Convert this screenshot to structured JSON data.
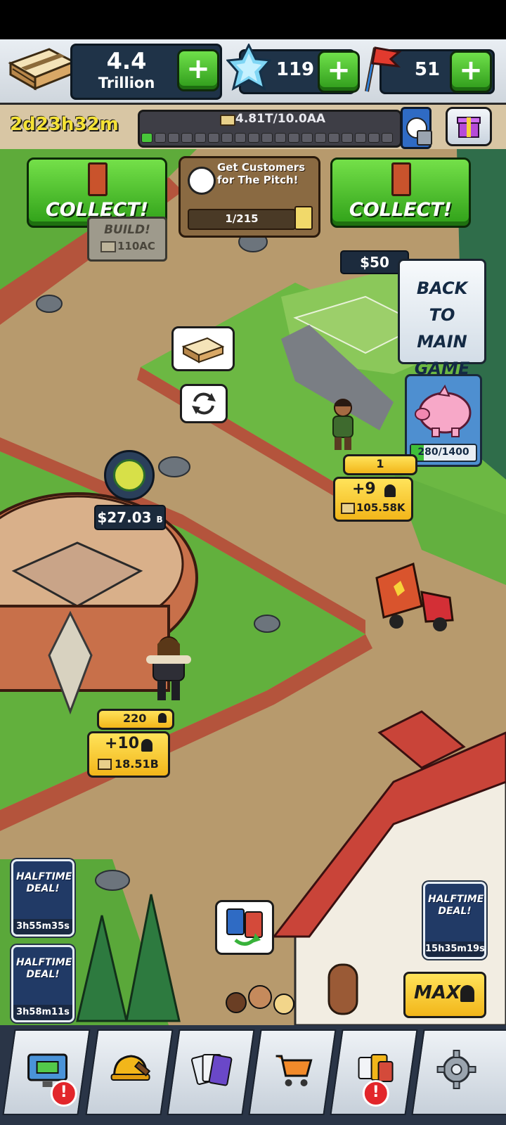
{
  "resources": {
    "cash_value": "4.4",
    "cash_unit": "Trillion",
    "gems": "119",
    "flags": "51"
  },
  "event": {
    "timer": "2d23h32m",
    "progress_text": "4.81T/10.0AA"
  },
  "field": {
    "collect_left": "COLLECT!",
    "collect_right": "COLLECT!",
    "build_label": "BUILD!",
    "build_cost": "110AC",
    "quest_title": "Get Customers for The Pitch!",
    "quest_progress": "1/215",
    "pitch_price": "$50",
    "back_to_main": "BACK TO MAIN GAME",
    "piggy_progress": "280/1400",
    "pitch_level": "1",
    "pitch_plus": "+9",
    "pitch_income": "105.58K",
    "arena_price": "$27.03",
    "arena_price_unit": "B",
    "arena_level": "220",
    "arena_plus": "+10",
    "arena_income": "18.51B",
    "max_label": "MAX"
  },
  "deals": {
    "deal1_title": "HALFTIME DEAL!",
    "deal1_timer": "3h55m35s",
    "deal2_title": "HALFTIME DEAL!",
    "deal2_timer": "3h58m11s",
    "deal3_title": "HALFTIME DEAL!",
    "deal3_timer": "15h35m19s"
  },
  "nav": {
    "alert1": "!",
    "alert5": "!"
  },
  "colors": {
    "green_button": "#2fa018",
    "dirt": "#b79a6d",
    "grass": "#5eab3a",
    "yellow_chip": "#f2b61a",
    "alert_red": "#e2262b"
  }
}
